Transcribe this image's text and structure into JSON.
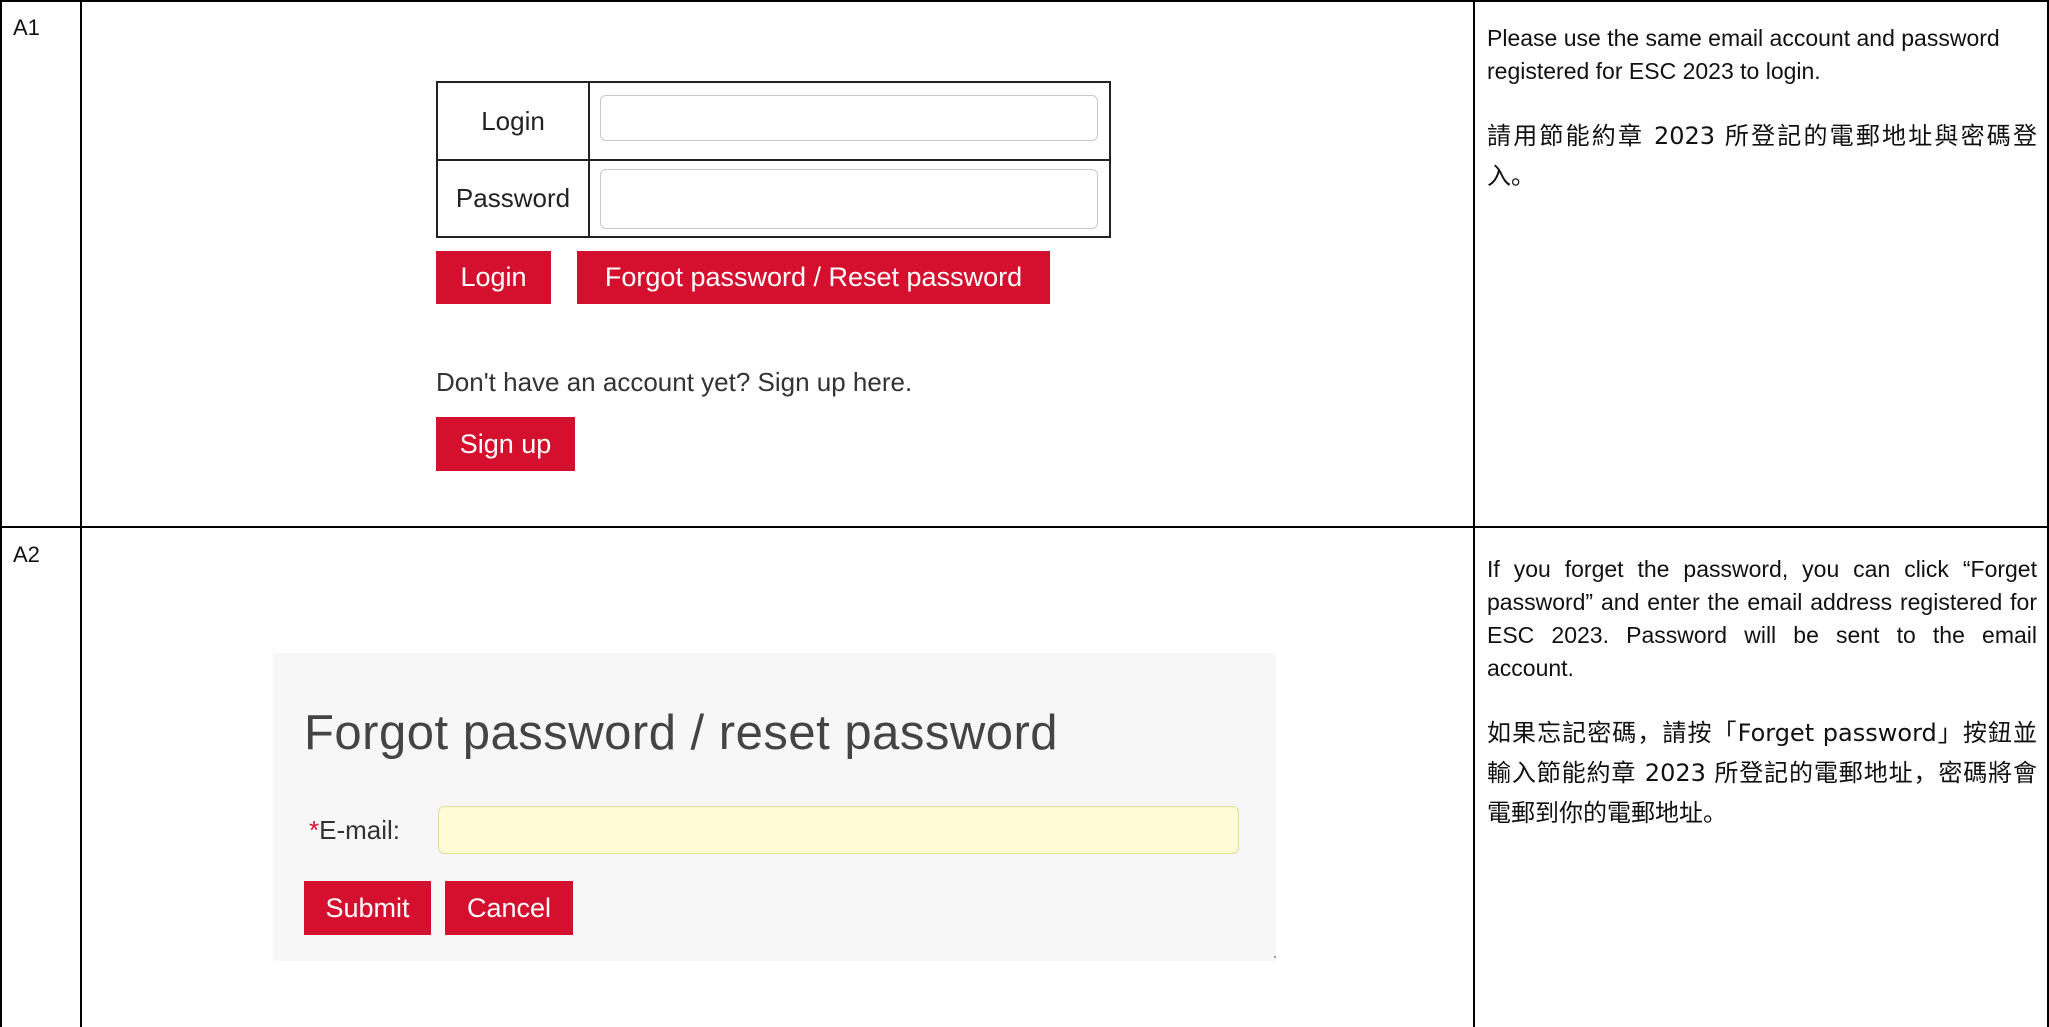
{
  "rows": [
    {
      "id": "A1",
      "login_form": {
        "login_label": "Login",
        "password_label": "Password",
        "login_value": "",
        "password_value": "",
        "login_button": "Login",
        "forgot_button": "Forgot password / Reset password",
        "signup_prompt": "Don't have an account yet? Sign up here.",
        "signup_button": "Sign up"
      },
      "note_en": "Please use the same email account and password registered for ESC 2023 to login.",
      "note_zh": "請用節能約章 2023 所登記的電郵地址與密碼登入。"
    },
    {
      "id": "A2",
      "forgot_form": {
        "title": "Forgot password / reset password",
        "required_mark": "*",
        "email_label": "E-mail:",
        "email_value": "",
        "submit_button": "Submit",
        "cancel_button": "Cancel"
      },
      "note_en": "If you forget the password, you can click “Forget password” and enter the email address registered for ESC 2023. Password will be sent to the email account.",
      "note_zh": "如果忘記密碼，請按「Forget password」按鈕並輸入節能約章 2023 所登記的電郵地址，密碼將會電郵到你的電郵地址。"
    }
  ],
  "colors": {
    "button_red": "#d4102e",
    "email_field_bg": "#fffbd5",
    "panel_bg": "#f7f7f7"
  }
}
